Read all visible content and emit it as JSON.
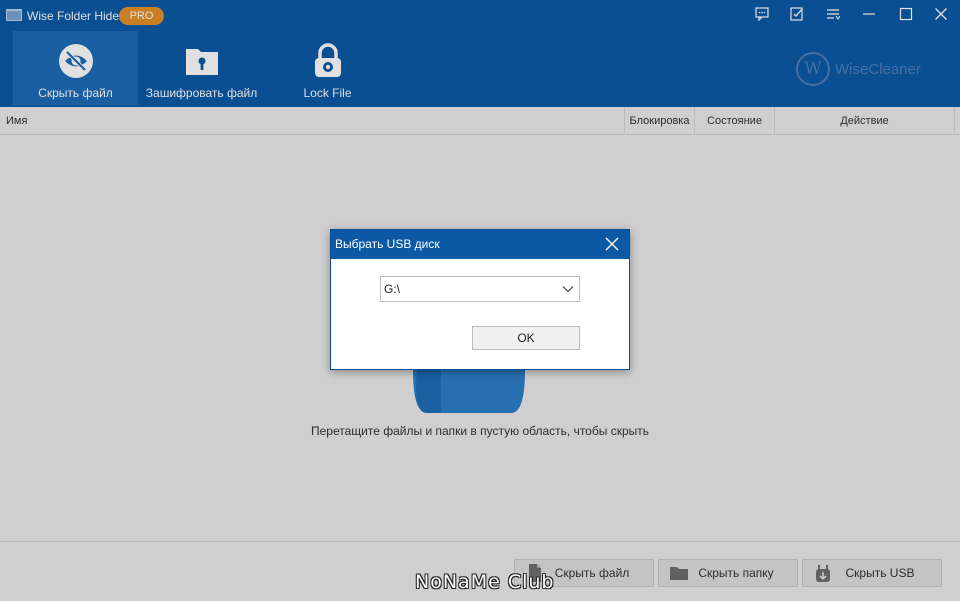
{
  "app": {
    "title": "Wise Folder Hider",
    "badge": "PRO"
  },
  "window_controls": [
    "feedback-icon",
    "notes-icon",
    "menu-icon",
    "minimize-icon",
    "maximize-icon",
    "close-icon"
  ],
  "toolbar": {
    "hide_file": "Скрыть файл",
    "encrypt_file": "Зашифровать файл",
    "lock_file": "Lock File"
  },
  "brand": {
    "logo": "W",
    "name": "WiseCleaner"
  },
  "table": {
    "columns": [
      "Имя",
      "Блокировка",
      "Состояние",
      "Действие"
    ]
  },
  "drop_hint": "Перетащите файлы и папки в пустую область, чтобы скрыть",
  "bottom": {
    "hide_file": "Скрыть файл",
    "hide_folder": "Скрыть папку",
    "hide_usb": "Скрыть USB"
  },
  "dialog": {
    "title": "Выбрать USB диск",
    "drive_value": "G:\\",
    "ok_label": "OK"
  },
  "watermark": "NoNaMe Club",
  "colors": {
    "header": "#0c5aa6",
    "active_tab": "#1d6bb7",
    "pro_badge": "#e8912b",
    "background": "#ececec"
  }
}
